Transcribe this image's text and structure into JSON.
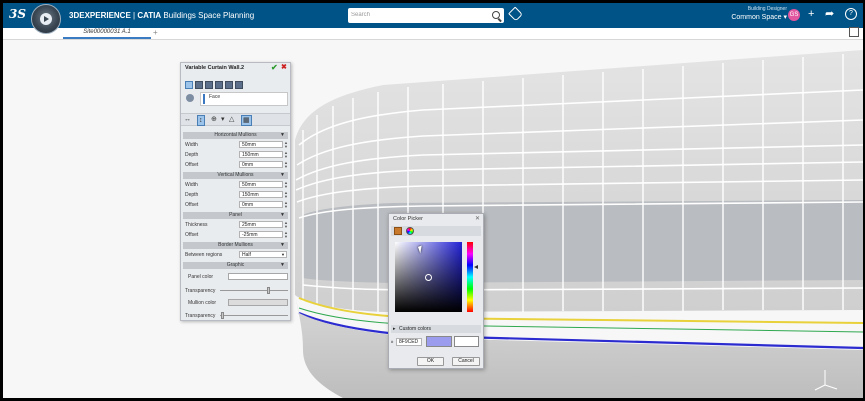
{
  "app": {
    "brand": "3DEXPERIENCE",
    "separator": " | ",
    "product": "CATIA",
    "app_name": "Buildings Space Planning",
    "logo_text": "3S"
  },
  "search": {
    "placeholder": "Search"
  },
  "role": {
    "label": "Building Designer",
    "space": "Common Space",
    "avatar_initials": "GS"
  },
  "tabs": [
    {
      "label": "Site00000031 A.1"
    }
  ],
  "tab_add_symbol": "+",
  "panel": {
    "title": "Variable Curtain Wall.2",
    "face_label": "Face",
    "sections": {
      "horizontal": "Horizontal Mullions",
      "vertical": "Vertical Mullions",
      "panel": "Panel",
      "border": "Border Mullions",
      "graphic": "Graphic"
    },
    "horizontal": {
      "width_label": "Width",
      "width": "50mm",
      "depth_label": "Depth",
      "depth": "150mm",
      "offset_label": "Offset",
      "offset": "0mm"
    },
    "vertical": {
      "width_label": "Width",
      "width": "50mm",
      "depth_label": "Depth",
      "depth": "150mm",
      "offset_label": "Offset",
      "offset": "0mm"
    },
    "panel_props": {
      "thickness_label": "Thickness",
      "thickness": "25mm",
      "offset_label": "Offset",
      "offset": "-25mm"
    },
    "border": {
      "between_label": "Between regions",
      "between_value": "Half"
    },
    "graphic": {
      "panel_color_label": "Panel color",
      "transparency_label": "Transparency",
      "panel_transparency": 0.72,
      "mullion_color_label": "Mullion color",
      "transparency2_label": "Transparency",
      "mullion_transparency": 0.02
    }
  },
  "color_picker": {
    "title": "Color Picker",
    "custom_colors_label": "Custom colors",
    "hex_value": "8F9CED",
    "current_color": "#9B9CED",
    "previous_color": "#FFFFFF",
    "ok_label": "OK",
    "cancel_label": "Cancel"
  },
  "colors": {
    "topbar": "#005386",
    "accent": "#3B7BC1",
    "floor_yellow": "#E8D13A",
    "floor_blue": "#2B2BD0",
    "floor_green": "#2FA84F"
  }
}
